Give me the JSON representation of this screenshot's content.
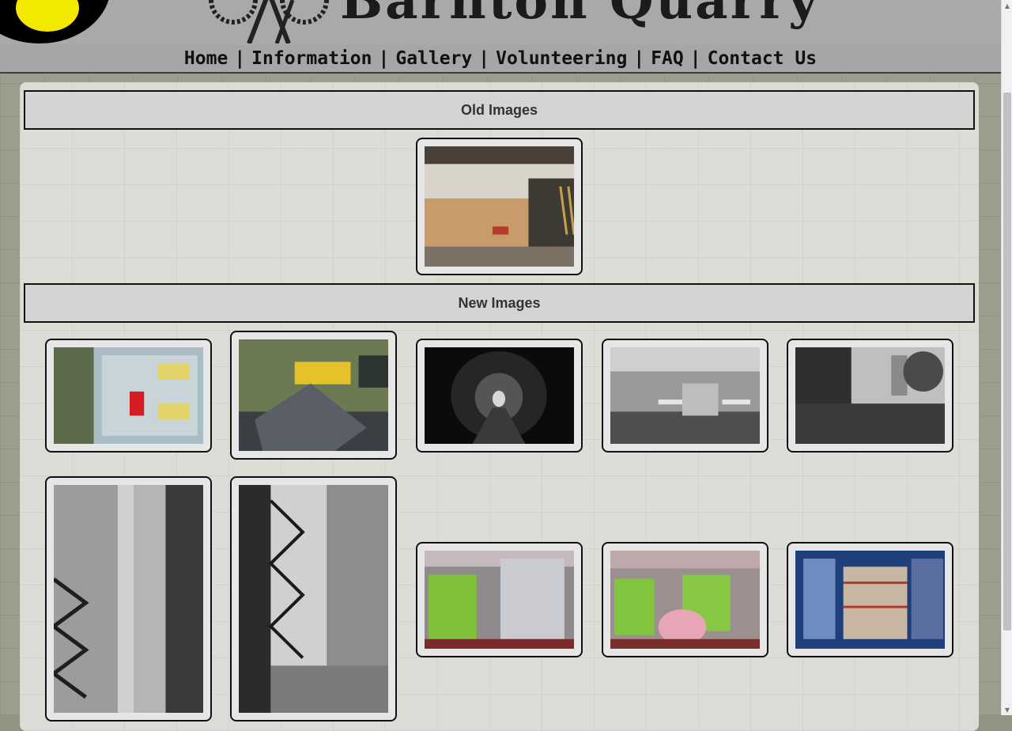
{
  "header": {
    "site_title": "Barnton Quarry"
  },
  "nav": {
    "items": [
      "Home",
      "Information",
      "Gallery",
      "Volunteering",
      "FAQ",
      "Contact Us"
    ],
    "separator": "|"
  },
  "sections": {
    "old_title": "Old Images",
    "new_title": "New Images"
  },
  "colors": {
    "header_bg": "#a9a9a9",
    "section_bar_bg": "#d4d4d4",
    "logo_yellow": "#f3e900"
  },
  "icons": {
    "scroll_up": "▲",
    "scroll_down": "▼"
  }
}
